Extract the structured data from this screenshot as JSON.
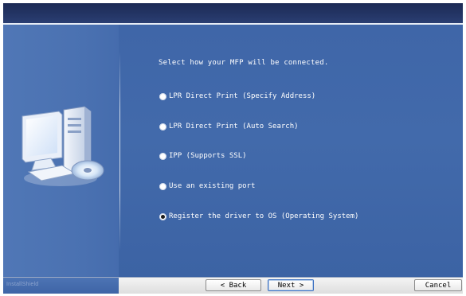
{
  "wizard": {
    "prompt": "Select how your MFP will be connected.",
    "options": [
      {
        "label": "LPR Direct Print (Specify Address)",
        "selected": false
      },
      {
        "label": "LPR Direct Print (Auto Search)",
        "selected": false
      },
      {
        "label": "IPP (Supports SSL)",
        "selected": false
      },
      {
        "label": "Use an existing port",
        "selected": false
      },
      {
        "label": "Register the driver to OS (Operating System)",
        "selected": true
      }
    ]
  },
  "footer": {
    "brand": "InstallShield",
    "back_label": "< Back",
    "next_label": "Next >",
    "cancel_label": "Cancel"
  }
}
